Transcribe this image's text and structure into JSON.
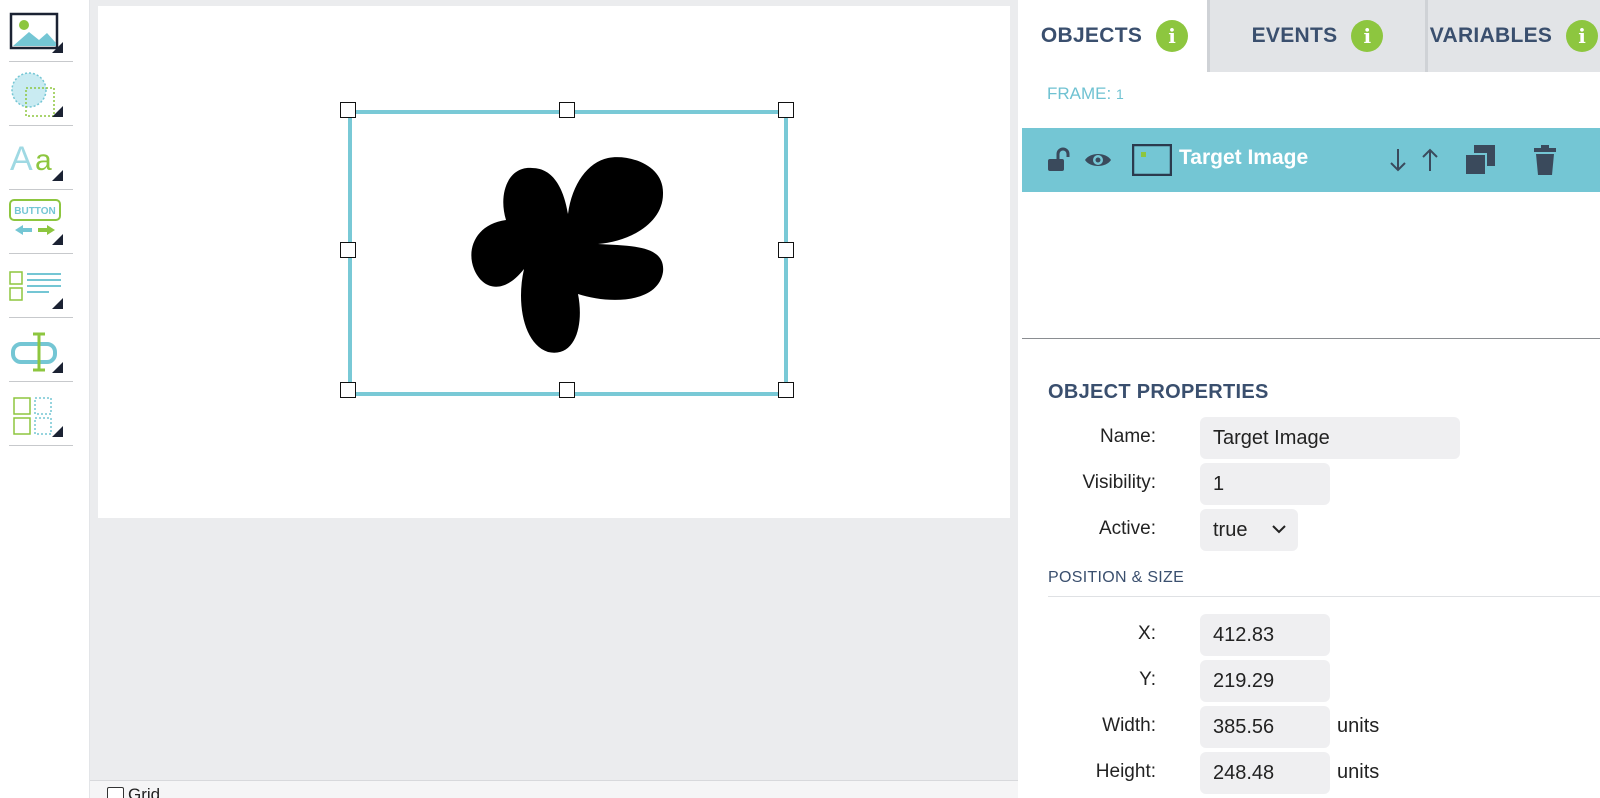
{
  "tabs": [
    {
      "label": "OBJECTS",
      "active": true
    },
    {
      "label": "EVENTS",
      "active": false
    },
    {
      "label": "VARIABLES",
      "active": false
    }
  ],
  "info_glyph": "i",
  "frame": {
    "label": "FRAME:",
    "number": "1"
  },
  "layer": {
    "name": "Target Image"
  },
  "toolbar_icons": [
    "image-tool-icon",
    "shape-tool-icon",
    "text-tool-icon",
    "button-tool-icon",
    "list-tool-icon",
    "input-tool-icon",
    "grid-tool-icon"
  ],
  "toolbar_button_text": "BUTTON",
  "properties": {
    "title": "OBJECT PROPERTIES",
    "name_label": "Name:",
    "name_value": "Target Image",
    "visibility_label": "Visibility:",
    "visibility_value": "1",
    "active_label": "Active:",
    "active_value": "true"
  },
  "position": {
    "title": "POSITION & SIZE",
    "x_label": "X:",
    "x_value": "412.83",
    "y_label": "Y:",
    "y_value": "219.29",
    "width_label": "Width:",
    "width_value": "385.56",
    "width_units": "units",
    "height_label": "Height:",
    "height_value": "248.48",
    "height_units": "units"
  },
  "bottom": {
    "grid_label": "Grid"
  },
  "colors": {
    "accent": "#74c6d4",
    "green": "#8dc63f",
    "navy": "#3a4f6e"
  }
}
